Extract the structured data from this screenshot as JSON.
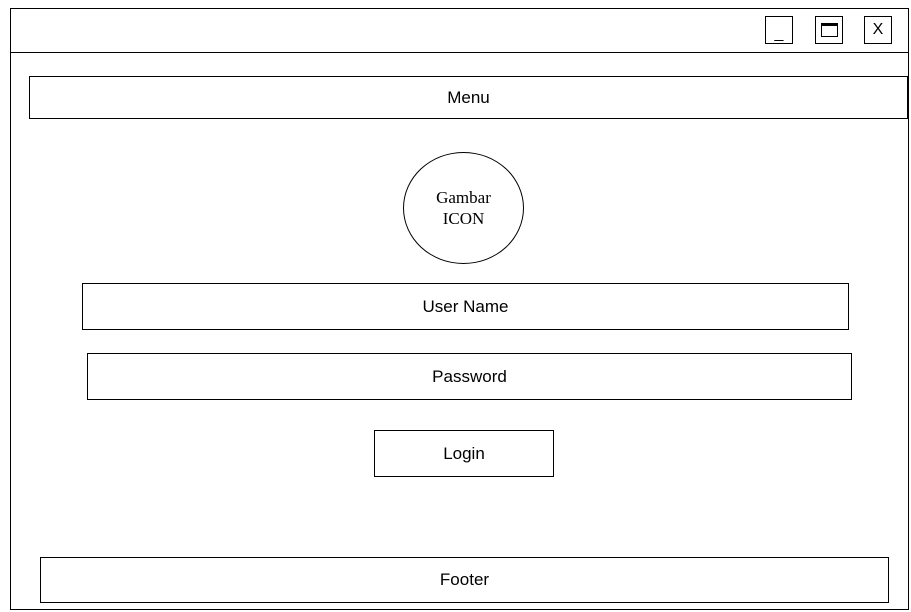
{
  "window": {
    "controls": {
      "minimize_label": "_",
      "close_label": "X",
      "maximize_icon": "maximize-icon"
    }
  },
  "menu": {
    "label": "Menu"
  },
  "logo": {
    "line1": "Gambar",
    "line2": "ICON"
  },
  "form": {
    "username_label": "User Name",
    "password_label": "Password",
    "login_label": "Login"
  },
  "footer": {
    "label": "Footer"
  }
}
